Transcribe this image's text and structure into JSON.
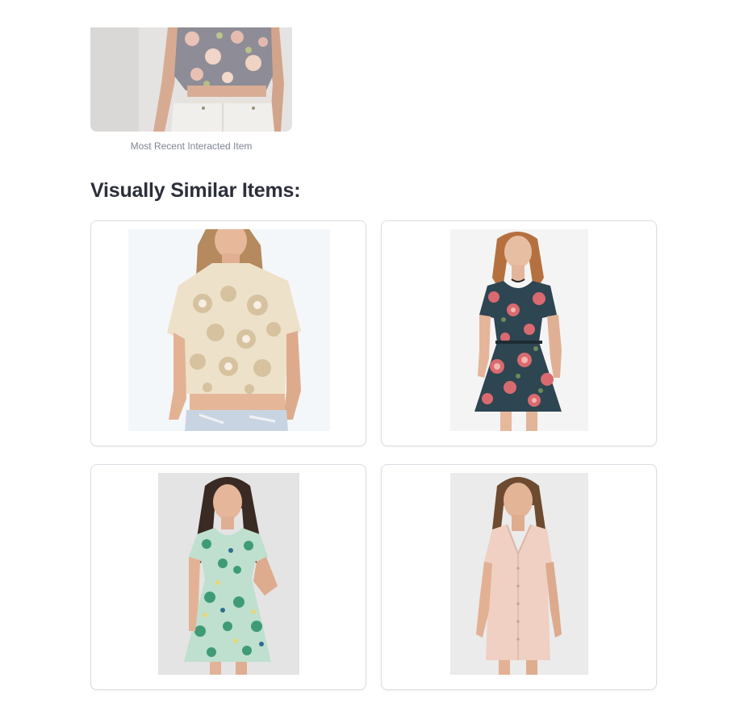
{
  "recent_item": {
    "caption": "Most Recent Interacted Item",
    "image": "floral-top-white-shorts-photo"
  },
  "similar_section": {
    "title": "Visually Similar Items:",
    "items": [
      {
        "image": "cream-lace-crop-top-photo"
      },
      {
        "image": "navy-floral-skater-dress-photo"
      },
      {
        "image": "green-floral-button-dress-photo"
      },
      {
        "image": "blush-sleeveless-shirt-dress-photo"
      }
    ]
  },
  "colors": {
    "card_border": "#dcdde3",
    "caption_text": "#808495",
    "title_text": "#2c2f3a",
    "background": "#ffffff"
  }
}
